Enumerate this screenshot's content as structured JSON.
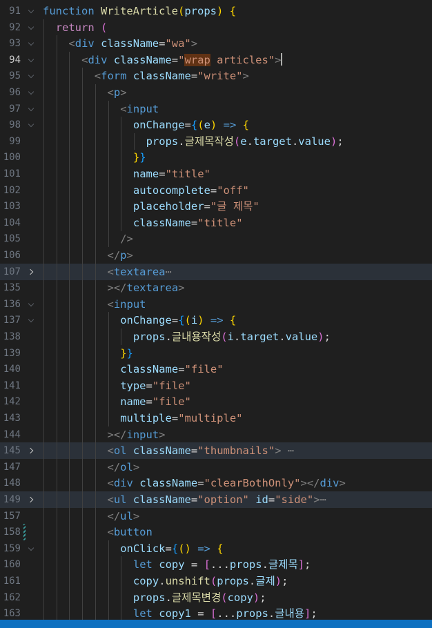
{
  "editor": {
    "lines": [
      {
        "num": "91",
        "fold": "open",
        "indent": 0,
        "tokens": [
          [
            "kw",
            "function"
          ],
          [
            "tx",
            " "
          ],
          [
            "fn",
            "WriteArticle"
          ],
          [
            "b1",
            "("
          ],
          [
            "vr",
            "props"
          ],
          [
            "b1",
            ")"
          ],
          [
            "tx",
            " "
          ],
          [
            "b1",
            "{"
          ]
        ]
      },
      {
        "num": "92",
        "fold": "open",
        "indent": 1,
        "tokens": [
          [
            "cf",
            "return"
          ],
          [
            "tx",
            " "
          ],
          [
            "b2",
            "("
          ]
        ]
      },
      {
        "num": "93",
        "fold": "open",
        "indent": 2,
        "tokens": [
          [
            "pn",
            "<"
          ],
          [
            "tg",
            "div"
          ],
          [
            "tx",
            " "
          ],
          [
            "vr",
            "className"
          ],
          [
            "tx",
            "="
          ],
          [
            "st",
            "\"wa\""
          ],
          [
            "pn",
            ">"
          ]
        ]
      },
      {
        "num": "94",
        "fold": "open",
        "indent": 3,
        "current": true,
        "tokens": [
          [
            "pn",
            "<"
          ],
          [
            "tg",
            "div"
          ],
          [
            "tx",
            " "
          ],
          [
            "vr",
            "className"
          ],
          [
            "tx",
            "="
          ],
          [
            "st",
            "\""
          ],
          [
            "st sel",
            "wrap"
          ],
          [
            "st",
            " articles\""
          ],
          [
            "pn",
            ">"
          ],
          [
            "cursor",
            ""
          ]
        ]
      },
      {
        "num": "95",
        "fold": "open",
        "indent": 4,
        "tokens": [
          [
            "pn",
            "<"
          ],
          [
            "tg",
            "form"
          ],
          [
            "tx",
            " "
          ],
          [
            "vr",
            "className"
          ],
          [
            "tx",
            "="
          ],
          [
            "st",
            "\"write\""
          ],
          [
            "pn",
            ">"
          ]
        ]
      },
      {
        "num": "96",
        "fold": "open",
        "indent": 5,
        "tokens": [
          [
            "pn",
            "<"
          ],
          [
            "tg",
            "p"
          ],
          [
            "pn",
            ">"
          ]
        ]
      },
      {
        "num": "97",
        "fold": "open",
        "indent": 6,
        "tokens": [
          [
            "pn",
            "<"
          ],
          [
            "tg",
            "input"
          ]
        ]
      },
      {
        "num": "98",
        "fold": "open",
        "indent": 7,
        "tokens": [
          [
            "vr",
            "onChange"
          ],
          [
            "tx",
            "="
          ],
          [
            "b3",
            "{"
          ],
          [
            "b1",
            "("
          ],
          [
            "vr",
            "e"
          ],
          [
            "b1",
            ")"
          ],
          [
            "tx",
            " "
          ],
          [
            "kw",
            "=>"
          ],
          [
            "tx",
            " "
          ],
          [
            "b1",
            "{"
          ]
        ]
      },
      {
        "num": "99",
        "fold": "",
        "indent": 8,
        "tokens": [
          [
            "vr",
            "props"
          ],
          [
            "tx",
            "."
          ],
          [
            "fn",
            "글제목작성"
          ],
          [
            "b2",
            "("
          ],
          [
            "vr",
            "e"
          ],
          [
            "tx",
            "."
          ],
          [
            "vr",
            "target"
          ],
          [
            "tx",
            "."
          ],
          [
            "vr",
            "value"
          ],
          [
            "b2",
            ")"
          ],
          [
            "tx",
            ";"
          ]
        ]
      },
      {
        "num": "100",
        "fold": "",
        "indent": 7,
        "tokens": [
          [
            "b1",
            "}"
          ],
          [
            "b3",
            "}"
          ]
        ]
      },
      {
        "num": "101",
        "fold": "",
        "indent": 7,
        "tokens": [
          [
            "vr",
            "name"
          ],
          [
            "tx",
            "="
          ],
          [
            "st",
            "\"title\""
          ]
        ]
      },
      {
        "num": "102",
        "fold": "",
        "indent": 7,
        "tokens": [
          [
            "vr",
            "autocomplete"
          ],
          [
            "tx",
            "="
          ],
          [
            "st",
            "\"off\""
          ]
        ]
      },
      {
        "num": "103",
        "fold": "",
        "indent": 7,
        "tokens": [
          [
            "vr",
            "placeholder"
          ],
          [
            "tx",
            "="
          ],
          [
            "st",
            "\"글 제목\""
          ]
        ]
      },
      {
        "num": "104",
        "fold": "",
        "indent": 7,
        "tokens": [
          [
            "vr",
            "className"
          ],
          [
            "tx",
            "="
          ],
          [
            "st",
            "\"title\""
          ]
        ]
      },
      {
        "num": "105",
        "fold": "",
        "indent": 6,
        "tokens": [
          [
            "pn",
            "/>"
          ]
        ]
      },
      {
        "num": "106",
        "fold": "",
        "indent": 5,
        "tokens": [
          [
            "pn",
            "</"
          ],
          [
            "tg",
            "p"
          ],
          [
            "pn",
            ">"
          ]
        ]
      },
      {
        "num": "107",
        "fold": "closed",
        "indent": 5,
        "folded": true,
        "tokens": [
          [
            "pn",
            "<"
          ],
          [
            "tg",
            "textarea"
          ],
          [
            "fe",
            "⋯"
          ]
        ]
      },
      {
        "num": "135",
        "fold": "",
        "indent": 5,
        "tokens": [
          [
            "pn",
            "></"
          ],
          [
            "tg",
            "textarea"
          ],
          [
            "pn",
            ">"
          ]
        ]
      },
      {
        "num": "136",
        "fold": "open",
        "indent": 5,
        "tokens": [
          [
            "pn",
            "<"
          ],
          [
            "tg",
            "input"
          ]
        ]
      },
      {
        "num": "137",
        "fold": "open",
        "indent": 6,
        "tokens": [
          [
            "vr",
            "onChange"
          ],
          [
            "tx",
            "="
          ],
          [
            "b3",
            "{"
          ],
          [
            "b1",
            "("
          ],
          [
            "vr",
            "i"
          ],
          [
            "b1",
            ")"
          ],
          [
            "tx",
            " "
          ],
          [
            "kw",
            "=>"
          ],
          [
            "tx",
            " "
          ],
          [
            "b1",
            "{"
          ]
        ]
      },
      {
        "num": "138",
        "fold": "",
        "indent": 7,
        "tokens": [
          [
            "vr",
            "props"
          ],
          [
            "tx",
            "."
          ],
          [
            "fn",
            "글내용작성"
          ],
          [
            "b2",
            "("
          ],
          [
            "vr",
            "i"
          ],
          [
            "tx",
            "."
          ],
          [
            "vr",
            "target"
          ],
          [
            "tx",
            "."
          ],
          [
            "vr",
            "value"
          ],
          [
            "b2",
            ")"
          ],
          [
            "tx",
            ";"
          ]
        ]
      },
      {
        "num": "139",
        "fold": "",
        "indent": 6,
        "tokens": [
          [
            "b1",
            "}"
          ],
          [
            "b3",
            "}"
          ]
        ]
      },
      {
        "num": "140",
        "fold": "",
        "indent": 6,
        "tokens": [
          [
            "vr",
            "className"
          ],
          [
            "tx",
            "="
          ],
          [
            "st",
            "\"file\""
          ]
        ]
      },
      {
        "num": "141",
        "fold": "",
        "indent": 6,
        "tokens": [
          [
            "vr",
            "type"
          ],
          [
            "tx",
            "="
          ],
          [
            "st",
            "\"file\""
          ]
        ]
      },
      {
        "num": "142",
        "fold": "",
        "indent": 6,
        "tokens": [
          [
            "vr",
            "name"
          ],
          [
            "tx",
            "="
          ],
          [
            "st",
            "\"file\""
          ]
        ]
      },
      {
        "num": "143",
        "fold": "",
        "indent": 6,
        "tokens": [
          [
            "vr",
            "multiple"
          ],
          [
            "tx",
            "="
          ],
          [
            "st",
            "\"multiple\""
          ]
        ]
      },
      {
        "num": "144",
        "fold": "",
        "indent": 5,
        "tokens": [
          [
            "pn",
            "></"
          ],
          [
            "tg",
            "input"
          ],
          [
            "pn",
            ">"
          ]
        ]
      },
      {
        "num": "145",
        "fold": "closed",
        "indent": 5,
        "folded": true,
        "tokens": [
          [
            "pn",
            "<"
          ],
          [
            "tg",
            "ol"
          ],
          [
            "tx",
            " "
          ],
          [
            "vr",
            "className"
          ],
          [
            "tx",
            "="
          ],
          [
            "st",
            "\"thumbnails\""
          ],
          [
            "pn",
            ">"
          ],
          [
            "fe",
            " ⋯"
          ]
        ]
      },
      {
        "num": "147",
        "fold": "",
        "indent": 5,
        "tokens": [
          [
            "pn",
            "</"
          ],
          [
            "tg",
            "ol"
          ],
          [
            "pn",
            ">"
          ]
        ]
      },
      {
        "num": "148",
        "fold": "",
        "indent": 5,
        "tokens": [
          [
            "pn",
            "<"
          ],
          [
            "tg",
            "div"
          ],
          [
            "tx",
            " "
          ],
          [
            "vr",
            "className"
          ],
          [
            "tx",
            "="
          ],
          [
            "st",
            "\"clearBothOnly\""
          ],
          [
            "pn",
            "></"
          ],
          [
            "tg",
            "div"
          ],
          [
            "pn",
            ">"
          ]
        ]
      },
      {
        "num": "149",
        "fold": "closed",
        "indent": 5,
        "folded": true,
        "tokens": [
          [
            "pn",
            "<"
          ],
          [
            "tg",
            "ul"
          ],
          [
            "tx",
            " "
          ],
          [
            "vr",
            "className"
          ],
          [
            "tx",
            "="
          ],
          [
            "st",
            "\"option\""
          ],
          [
            "tx",
            " "
          ],
          [
            "vr",
            "id"
          ],
          [
            "tx",
            "="
          ],
          [
            "st",
            "\"side\""
          ],
          [
            "pn",
            ">"
          ],
          [
            "fe",
            "⋯"
          ]
        ]
      },
      {
        "num": "157",
        "fold": "",
        "indent": 5,
        "tokens": [
          [
            "pn",
            "</"
          ],
          [
            "tg",
            "ul"
          ],
          [
            "pn",
            ">"
          ]
        ]
      },
      {
        "num": "158",
        "fold": "mod",
        "indent": 5,
        "tokens": [
          [
            "pn",
            "<"
          ],
          [
            "tg",
            "button"
          ]
        ]
      },
      {
        "num": "159",
        "fold": "open",
        "indent": 6,
        "tokens": [
          [
            "vr",
            "onClick"
          ],
          [
            "tx",
            "="
          ],
          [
            "b3",
            "{"
          ],
          [
            "b1",
            "()"
          ],
          [
            "tx",
            " "
          ],
          [
            "kw",
            "=>"
          ],
          [
            "tx",
            " "
          ],
          [
            "b1",
            "{"
          ]
        ]
      },
      {
        "num": "160",
        "fold": "",
        "indent": 7,
        "tokens": [
          [
            "kw",
            "let"
          ],
          [
            "tx",
            " "
          ],
          [
            "vr",
            "copy"
          ],
          [
            "tx",
            " = "
          ],
          [
            "b2",
            "["
          ],
          [
            "tx",
            "..."
          ],
          [
            "vr",
            "props"
          ],
          [
            "tx",
            "."
          ],
          [
            "vr",
            "글제목"
          ],
          [
            "b2",
            "]"
          ],
          [
            "tx",
            ";"
          ]
        ]
      },
      {
        "num": "161",
        "fold": "",
        "indent": 7,
        "tokens": [
          [
            "vr",
            "copy"
          ],
          [
            "tx",
            "."
          ],
          [
            "fn",
            "unshift"
          ],
          [
            "b2",
            "("
          ],
          [
            "vr",
            "props"
          ],
          [
            "tx",
            "."
          ],
          [
            "vr",
            "글제"
          ],
          [
            "b2",
            ")"
          ],
          [
            "tx",
            ";"
          ]
        ]
      },
      {
        "num": "162",
        "fold": "",
        "indent": 7,
        "tokens": [
          [
            "vr",
            "props"
          ],
          [
            "tx",
            "."
          ],
          [
            "fn",
            "글제목변경"
          ],
          [
            "b2",
            "("
          ],
          [
            "vr",
            "copy"
          ],
          [
            "b2",
            ")"
          ],
          [
            "tx",
            ";"
          ]
        ]
      },
      {
        "num": "163",
        "fold": "",
        "indent": 7,
        "tokens": [
          [
            "kw",
            "let"
          ],
          [
            "tx",
            " "
          ],
          [
            "vr",
            "copy1"
          ],
          [
            "tx",
            " = "
          ],
          [
            "b2",
            "["
          ],
          [
            "tx",
            "..."
          ],
          [
            "vr",
            "props"
          ],
          [
            "tx",
            "."
          ],
          [
            "vr",
            "글내용"
          ],
          [
            "b2",
            "]"
          ],
          [
            "tx",
            ";"
          ]
        ]
      }
    ]
  }
}
